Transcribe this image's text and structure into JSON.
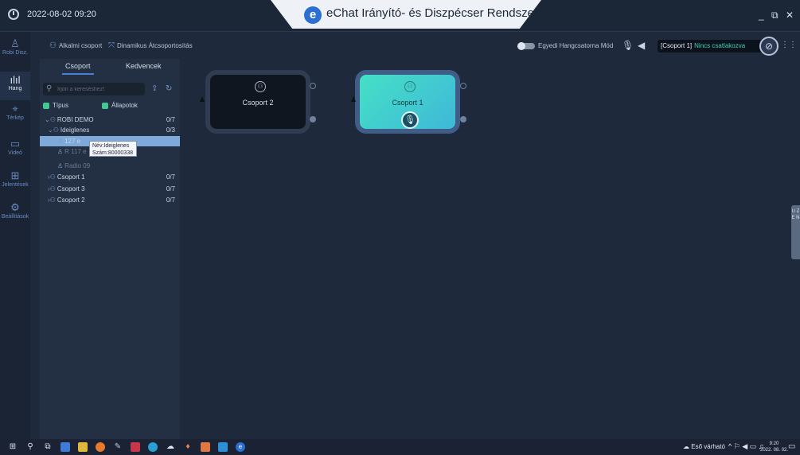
{
  "titlebar": {
    "datetime": "2022-08-02 09:20",
    "app_title": "eChat Irányító- és Diszpécser Rendszer",
    "logo_letter": "e",
    "controls": [
      "_",
      "⧉",
      "✕"
    ]
  },
  "rail": {
    "items": [
      {
        "label": "Robi Disz.",
        "icon": "user-icon"
      },
      {
        "label": "Hang",
        "icon": "audio-wave-icon",
        "active": true
      },
      {
        "label": "Térkép",
        "icon": "map-pin-icon"
      },
      {
        "label": "Videó",
        "icon": "video-icon"
      },
      {
        "label": "Jelentések",
        "icon": "table-icon"
      },
      {
        "label": "Beállítások",
        "icon": "gear-icon"
      }
    ]
  },
  "toolbar": {
    "temp_group": "Alkalmi csoport",
    "dynamic_regroup": "Dinamikus Átcsoportosítás",
    "single_voice_mode": "Egyedi Hangcsatorna Mód",
    "status_group": "[Csoport 1]",
    "status_text": "Nincs csatlakozva"
  },
  "panel": {
    "tabs": [
      "Csoport",
      "Kedvencek"
    ],
    "search_placeholder": "Írjon a kereséshez!",
    "filter_type": "Típus",
    "filter_status": "Állapotok",
    "tree": [
      {
        "name": "ROBI DEMO",
        "count": "0/7"
      },
      {
        "name": "Ideiglenes",
        "count": "0/3"
      },
      {
        "name": "127 e",
        "count": ""
      },
      {
        "name": "R 117 e",
        "count": ""
      },
      {
        "name": "Radio 09",
        "count": ""
      },
      {
        "name": "Csoport 1",
        "count": "0/7"
      },
      {
        "name": "Csoport 3",
        "count": "0/7"
      },
      {
        "name": "Csoport 2",
        "count": "0/7"
      }
    ],
    "tooltip": {
      "line1": "Név:Ideiglenes",
      "line2": "Szám:80000338"
    }
  },
  "groups": [
    {
      "name": "Csoport 2",
      "state": "idle"
    },
    {
      "name": "Csoport 1",
      "state": "active"
    }
  ],
  "side_tab": "U Z E N",
  "taskbar": {
    "weather": "Eső várható",
    "time": "9:20",
    "date": "2022. 08. 02."
  }
}
